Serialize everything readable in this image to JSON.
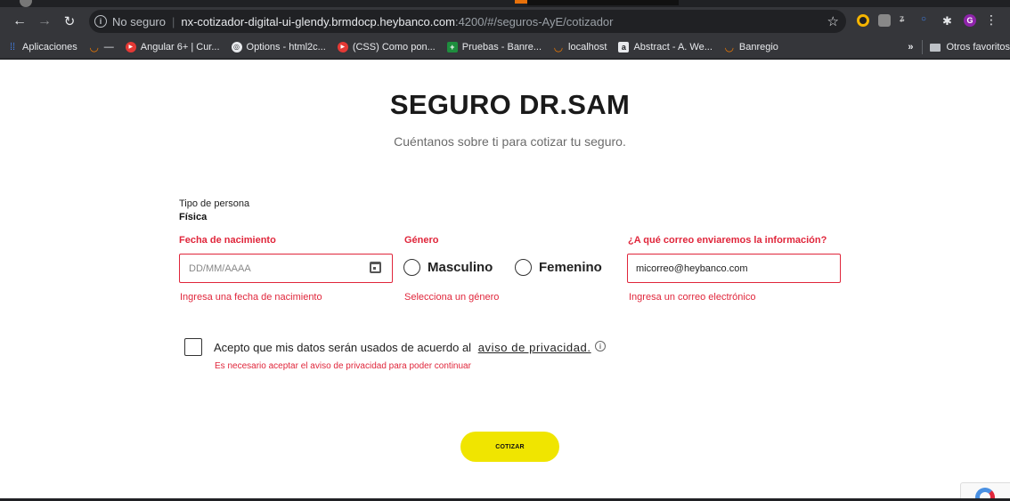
{
  "browser": {
    "security_label": "No seguro",
    "url_host": "nx-cotizador-digital-ui-glendy.brmdocp.heybanco.com",
    "url_path": ":4200/#/seguros-AyE/cotizador",
    "bookmarks": [
      {
        "label": "Aplicaciones",
        "icon": "apps-grid-icon"
      },
      {
        "label": "—",
        "icon": "smile-icon"
      },
      {
        "label": "Angular 6+ | Cur...",
        "icon": "youtube-icon"
      },
      {
        "label": "Options - html2c...",
        "icon": "globe-icon"
      },
      {
        "label": "(CSS) Como pon...",
        "icon": "youtube-icon"
      },
      {
        "label": "Pruebas - Banre...",
        "icon": "plus-icon"
      },
      {
        "label": "localhost",
        "icon": "smile-icon"
      },
      {
        "label": "Abstract - A. We...",
        "icon": "abstract-icon"
      },
      {
        "label": "Banregio",
        "icon": "smile-icon"
      }
    ],
    "other_bookmarks": "Otros favoritos",
    "chevron": "»",
    "avatar_letter": "G"
  },
  "page": {
    "title": "SEGURO DR.SAM",
    "subtitle": "Cuéntanos sobre ti para cotizar tu seguro.",
    "persona_label": "Tipo de persona",
    "persona_value": "Física",
    "birthdate": {
      "label": "Fecha de nacimiento",
      "placeholder": "DD/MM/AAAA",
      "error": "Ingresa una fecha de nacimiento"
    },
    "gender": {
      "label": "Género",
      "options": [
        "Masculino",
        "Femenino"
      ],
      "error": "Selecciona un género"
    },
    "email": {
      "label": "¿A qué correo enviaremos la información?",
      "value": "micorreo@heybanco.com",
      "error": "Ingresa un correo electrónico"
    },
    "consent": {
      "text": "Acepto que mis datos serán usados de acuerdo al",
      "link": "aviso de privacidad.",
      "error": "Es necesario aceptar el aviso de privacidad para poder continuar"
    },
    "submit_label": "COTIZAR"
  },
  "colors": {
    "accent_error": "#e0263b",
    "cta_yellow": "#f0e500"
  }
}
